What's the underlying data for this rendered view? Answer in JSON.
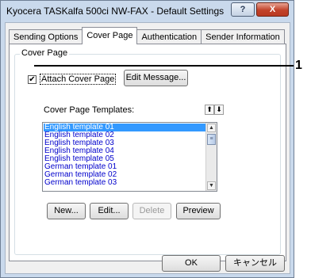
{
  "window": {
    "title": "Kyocera TASKalfa 500ci NW-FAX - Default Settings",
    "help_label": "?",
    "close_label": "X"
  },
  "tabs": [
    {
      "label": "Sending Options",
      "active": false
    },
    {
      "label": "Cover Page",
      "active": true
    },
    {
      "label": "Authentication",
      "active": false
    },
    {
      "label": "Sender Information",
      "active": false
    }
  ],
  "cover_page": {
    "group_label": "Cover Page",
    "attach_label": "Attach Cover Page",
    "attach_checked": true,
    "check_glyph": "✔",
    "edit_message_label": "Edit Message...",
    "templates_label": "Cover Page Templates:",
    "move_up_glyph": "⬆",
    "move_down_glyph": "⬇",
    "templates": [
      "English template 01",
      "English template 02",
      "English template 03",
      "English template 04",
      "English template 05",
      "German template 01",
      "German template 02",
      "German template 03"
    ],
    "selected_index": 0,
    "scroll_up_glyph": "▲",
    "scroll_down_glyph": "▼",
    "scroll_thumb_glyph": "≡",
    "buttons": {
      "new": "New...",
      "edit": "Edit...",
      "delete": "Delete",
      "preview": "Preview"
    }
  },
  "footer": {
    "ok": "OK",
    "cancel": "キャンセル"
  },
  "callout": {
    "number": "1"
  }
}
